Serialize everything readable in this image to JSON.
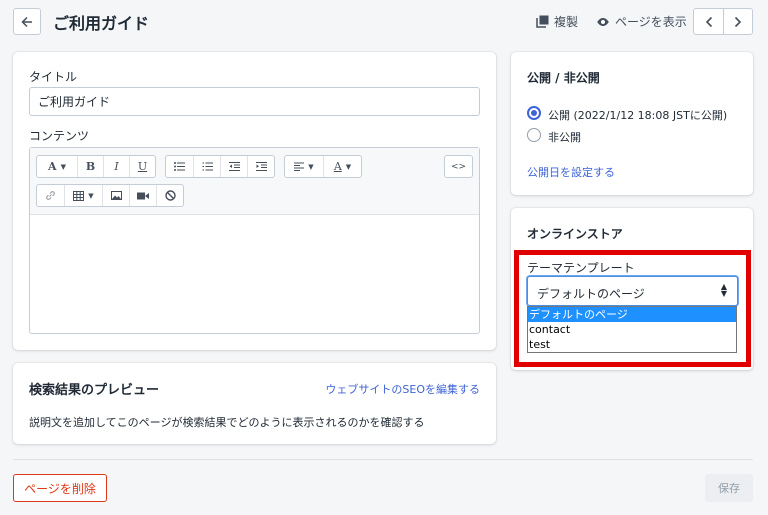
{
  "header": {
    "title": "ご利用ガイド",
    "duplicate_label": "複製",
    "view_page_label": "ページを表示"
  },
  "main_card": {
    "title_label": "タイトル",
    "title_value": "ご利用ガイド",
    "content_label": "コンテンツ",
    "toolbar": {
      "font_button": "A",
      "bold": "B",
      "italic": "I",
      "underline": "U",
      "color_button": "A",
      "html_button": "<>"
    }
  },
  "seo_card": {
    "title": "検索結果のプレビュー",
    "edit_link": "ウェブサイトのSEOを編集する",
    "description": "説明文を追加してこのページが検索結果でどのように表示されるのかを確認する"
  },
  "visibility_card": {
    "title": "公開 / 非公開",
    "options": [
      {
        "label": "公開 (2022/1/12 18:08 JSTに公開)",
        "checked": true
      },
      {
        "label": "非公開",
        "checked": false
      }
    ],
    "set_date_link": "公開日を設定する"
  },
  "online_store_card": {
    "title": "オンラインストア",
    "template_label": "テーマテンプレート",
    "template_selected": "デフォルトのページ",
    "template_options": [
      "デフォルトのページ",
      "contact",
      "test"
    ]
  },
  "footer": {
    "delete_label": "ページを削除",
    "save_label": "保存"
  },
  "colors": {
    "accent": "#3e63d9",
    "danger": "#de3618",
    "highlight_box": "#e00000",
    "option_selected": "#1e90ff"
  },
  "icons": [
    "back-arrow-icon",
    "duplicate-icon",
    "eye-icon",
    "chevron-left-icon",
    "chevron-right-icon",
    "bullet-list-icon",
    "numbered-list-icon",
    "outdent-icon",
    "indent-icon",
    "align-left-icon",
    "link-icon",
    "table-icon",
    "image-icon",
    "video-icon",
    "clear-format-icon"
  ]
}
